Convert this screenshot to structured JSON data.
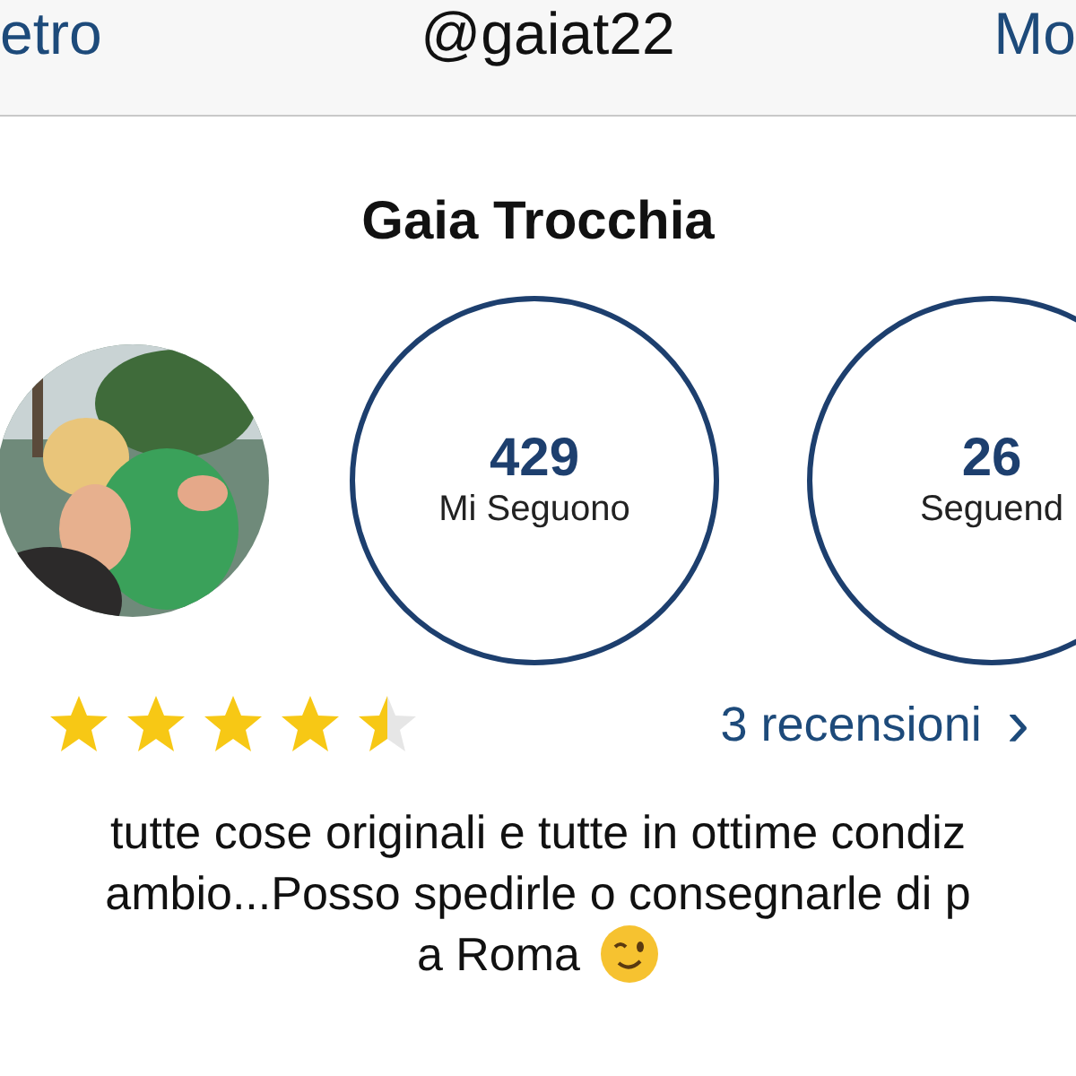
{
  "nav": {
    "back": "etro",
    "title": "@gaiat22",
    "more": "Mo"
  },
  "profile": {
    "name": "Gaia Trocchia",
    "stats": [
      {
        "value": "429",
        "label": "Mi Seguono"
      },
      {
        "value": "26",
        "label": "Seguend"
      }
    ],
    "stars": 4.5,
    "reviews": "3 recensioni",
    "reviews_arrow": "›"
  },
  "bio_lines": [
    "tutte cose originali e tutte in ottime condiz",
    "ambio...Posso spedirle o consegnarle di p",
    "a Roma"
  ]
}
